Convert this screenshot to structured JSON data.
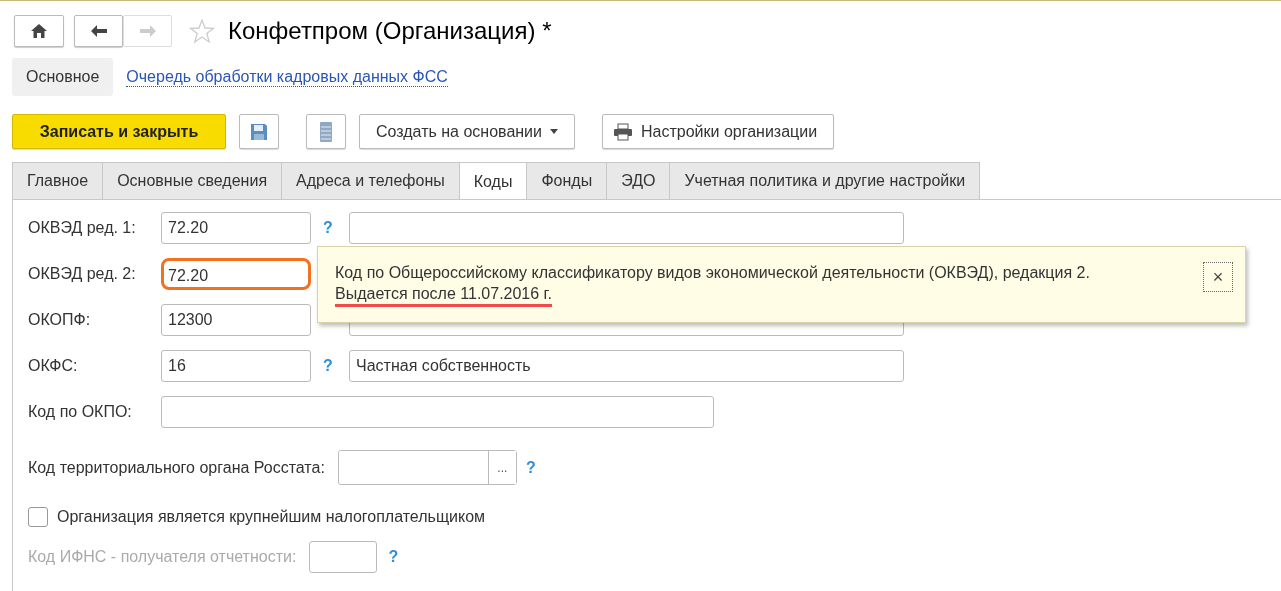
{
  "header": {
    "title": "Конфетпром (Организация) *",
    "forward_disabled": true,
    "favorite": false
  },
  "sections": [
    {
      "label": "Основное",
      "selected": true,
      "kind": "tab"
    },
    {
      "label": "Очередь обработки кадровых данных ФСС",
      "selected": false,
      "kind": "link"
    }
  ],
  "toolbar": [
    {
      "kind": "primary",
      "label": "Записать и закрыть"
    },
    {
      "kind": "save"
    },
    {
      "kind": "list"
    },
    {
      "kind": "dropdown",
      "label": "Создать на основании"
    },
    {
      "kind": "print",
      "label": "Настройки организации"
    }
  ],
  "tabs": [
    {
      "label": "Главное",
      "selected": false
    },
    {
      "label": "Основные сведения",
      "selected": false
    },
    {
      "label": "Адреса и телефоны",
      "selected": false
    },
    {
      "label": "Коды",
      "selected": true
    },
    {
      "label": "Фонды",
      "selected": false
    },
    {
      "label": "ЭДО",
      "selected": false
    },
    {
      "label": "Учетная политика и другие настройки",
      "selected": false
    }
  ],
  "fields": [
    {
      "kind": "code",
      "label": "ОКВЭД ред. 1:",
      "value": "72.20",
      "help": "?",
      "highlighted": false
    },
    {
      "kind": "covered",
      "label": "ОКВЭД ред. 2:",
      "value": "72.20",
      "highlighted": true
    },
    {
      "kind": "code",
      "label": "ОКОПФ:",
      "value": "12300",
      "highlighted": false
    },
    {
      "kind": "code",
      "label": "ОКФС:",
      "value": "16",
      "help": "?",
      "description": "Частная собственность",
      "highlighted": false
    },
    {
      "kind": "wide",
      "label": "Код по ОКПО:"
    },
    {
      "kind": "select",
      "label": "Код территориального органа Росстата:",
      "button": "...",
      "help": "?"
    },
    {
      "kind": "checkbox",
      "label": "Организация является крупнейшим налогоплательщиком",
      "checked": false
    },
    {
      "kind": "small",
      "label": "Код ИФНС - получателя отчетности:",
      "help": "?",
      "disabled": true
    }
  ],
  "tooltip": {
    "text": "Код по Общероссийскому классификатору видов экономической деятельности (ОКВЭД), редакция 2.",
    "note": "Выдается после 11.07.2016 г.",
    "note_underlined": true,
    "close": "×"
  }
}
